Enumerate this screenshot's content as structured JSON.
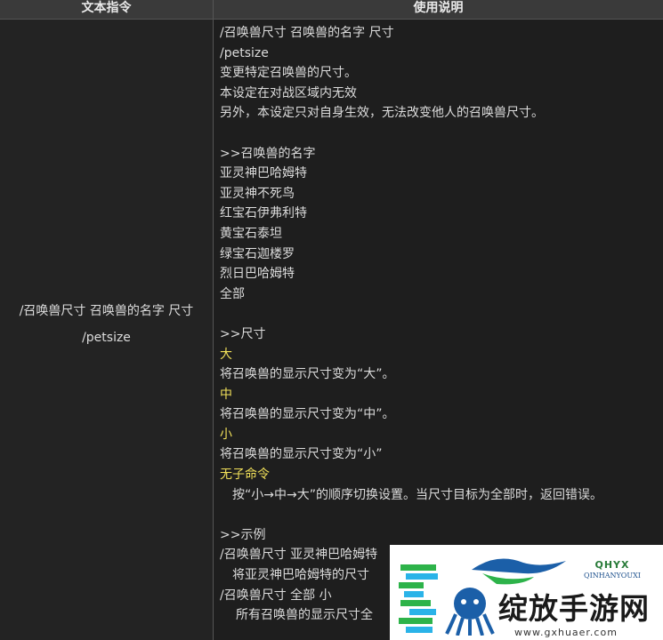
{
  "table": {
    "headers": [
      "文本指令",
      "使用说明"
    ],
    "command_col": [
      "/召唤兽尺寸 召唤兽的名字 尺寸",
      "/petsize"
    ],
    "description_lines": [
      {
        "text": "/召唤兽尺寸 召唤兽的名字 尺寸",
        "style": "normal"
      },
      {
        "text": "/petsize",
        "style": "normal"
      },
      {
        "text": "变更特定召唤兽的尺寸。",
        "style": "normal"
      },
      {
        "text": "本设定在对战区域内无效",
        "style": "normal"
      },
      {
        "text": "另外，本设定只对自身生效，无法改变他人的召唤兽尺寸。",
        "style": "normal"
      },
      {
        "text": "",
        "style": "normal"
      },
      {
        "text": ">>召唤兽的名字",
        "style": "normal"
      },
      {
        "text": "亚灵神巴哈姆特",
        "style": "normal"
      },
      {
        "text": "亚灵神不死鸟",
        "style": "normal"
      },
      {
        "text": "红宝石伊弗利特",
        "style": "normal"
      },
      {
        "text": "黄宝石泰坦",
        "style": "normal"
      },
      {
        "text": "绿宝石迦楼罗",
        "style": "normal"
      },
      {
        "text": "烈日巴哈姆特",
        "style": "normal"
      },
      {
        "text": "全部",
        "style": "normal"
      },
      {
        "text": "",
        "style": "normal"
      },
      {
        "text": ">>尺寸",
        "style": "normal"
      },
      {
        "text": "大",
        "style": "yellow"
      },
      {
        "text": "将召唤兽的显示尺寸变为“大”。",
        "style": "normal"
      },
      {
        "text": "中",
        "style": "yellow"
      },
      {
        "text": "将召唤兽的显示尺寸变为“中”。",
        "style": "normal"
      },
      {
        "text": "小",
        "style": "yellow"
      },
      {
        "text": "将召唤兽的显示尺寸变为“小”",
        "style": "normal"
      },
      {
        "text": "无子命令",
        "style": "yellow"
      },
      {
        "text": "按“小→中→大”的顺序切换设置。当尺寸目标为全部时，返回错误。",
        "style": "indent"
      },
      {
        "text": "",
        "style": "normal"
      },
      {
        "text": ">>示例",
        "style": "normal"
      },
      {
        "text": "/召唤兽尺寸 亚灵神巴哈姆特",
        "style": "normal"
      },
      {
        "text": "将亚灵神巴哈姆特的尺寸",
        "style": "indent"
      },
      {
        "text": "/召唤兽尺寸 全部 小",
        "style": "normal"
      },
      {
        "text": "所有召唤兽的显示尺寸全",
        "style": "indent2"
      }
    ]
  },
  "watermark": {
    "brand_cn": "QHYX",
    "brand_en": "QINHANYOUXI",
    "title": "绽放手游网",
    "url": "www.gxhuaer.com",
    "colors": {
      "green": "#2db34a",
      "blue": "#1b5fa8",
      "cyan": "#2ab3e8"
    }
  }
}
